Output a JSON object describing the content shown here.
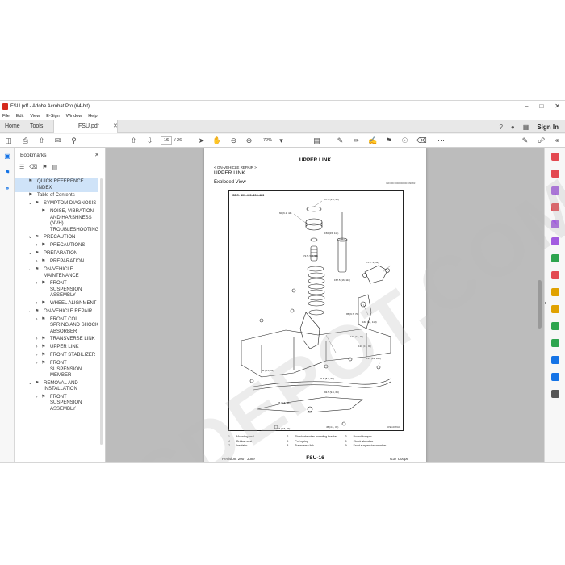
{
  "window": {
    "title": "FSU.pdf - Adobe Acrobat Pro (64-bit)"
  },
  "menu": [
    "File",
    "Edit",
    "View",
    "E-Sign",
    "Window",
    "Help"
  ],
  "tabs": {
    "home": "Home",
    "tools": "Tools",
    "document": "FSU.pdf",
    "sign_in": "Sign In"
  },
  "toolbar": {
    "current_page": "16",
    "page_total": "/ 26",
    "zoom": "72%"
  },
  "bookmarks": {
    "header": "Bookmarks",
    "items": [
      {
        "label": "QUICK REFERENCE INDEX",
        "level": 0,
        "expand": "",
        "selected": true
      },
      {
        "label": "Table of Contents",
        "level": 0,
        "expand": "",
        "selected": false
      },
      {
        "label": "SYMPTOM DIAGNOSIS",
        "level": 1,
        "expand": "v",
        "selected": false
      },
      {
        "label": "NOISE, VIBRATION AND HARSHNESS (NVH) TROUBLESHOOTING",
        "level": 2,
        "expand": "",
        "selected": false
      },
      {
        "label": "PRECAUTION",
        "level": 1,
        "expand": "v",
        "selected": false
      },
      {
        "label": "PRECAUTIONS",
        "level": 2,
        "expand": ">",
        "selected": false
      },
      {
        "label": "PREPARATION",
        "level": 1,
        "expand": "v",
        "selected": false
      },
      {
        "label": "PREPARATION",
        "level": 2,
        "expand": ">",
        "selected": false
      },
      {
        "label": "ON-VEHICLE MAINTENANCE",
        "level": 1,
        "expand": "v",
        "selected": false
      },
      {
        "label": "FRONT SUSPENSION ASSEMBLY",
        "level": 2,
        "expand": ">",
        "selected": false
      },
      {
        "label": "WHEEL ALIGNMENT",
        "level": 2,
        "expand": ">",
        "selected": false
      },
      {
        "label": "ON-VEHICLE REPAIR",
        "level": 1,
        "expand": "v",
        "selected": false
      },
      {
        "label": "FRONT COIL SPRING AND SHOCK ABSORBER",
        "level": 2,
        "expand": ">",
        "selected": false
      },
      {
        "label": "TRANSVERSE LINK",
        "level": 2,
        "expand": ">",
        "selected": false
      },
      {
        "label": "UPPER LINK",
        "level": 2,
        "expand": ">",
        "selected": false
      },
      {
        "label": "FRONT STABILIZER",
        "level": 2,
        "expand": ">",
        "selected": false
      },
      {
        "label": "FRONT SUSPENSION MEMBER",
        "level": 2,
        "expand": ">",
        "selected": false
      },
      {
        "label": "REMOVAL AND INSTALLATION",
        "level": 1,
        "expand": "v",
        "selected": false
      },
      {
        "label": "FRONT SUSPENSION ASSEMBLY",
        "level": 2,
        "expand": ">",
        "selected": false
      }
    ]
  },
  "page": {
    "title": "UPPER LINK",
    "breadcrumb": "< ON-VEHICLE REPAIR >",
    "subtitle": "UPPER LINK",
    "view_label": "Exploded View",
    "page_code": "INFOID:0000000001390817",
    "diagram_section": "SEC. 400•401•408•483",
    "diagram_code": "JPEIA0083GB",
    "legend": [
      [
        {
          "n": "1.",
          "t": "Mounting seal"
        },
        {
          "n": "2.",
          "t": "Shock absorber mounting bracket"
        },
        {
          "n": "3.",
          "t": "Bound bumper"
        }
      ],
      [
        {
          "n": "4.",
          "t": "Rubber seat"
        },
        {
          "n": "5.",
          "t": "Coil spring"
        },
        {
          "n": "6.",
          "t": "Shock absorber"
        }
      ],
      [
        {
          "n": "7.",
          "t": "Insulator"
        },
        {
          "n": "8.",
          "t": "Transverse link"
        },
        {
          "n": "9.",
          "t": "Front suspension member"
        }
      ]
    ],
    "callouts": [
      "37.3 (3.8, 28)",
      "60 (6.1, 44)",
      "70 (7.1, 52)",
      "150 (15, 111)",
      "72.5 (7.4, 53)",
      "157.5 (16, 116)",
      "95 (9.7, 70)",
      "160 (16, 118)",
      "130 (13, 96)",
      "130 (13, 96)",
      "135 (14, 100)",
      "81.5 (8.3, 60)",
      "93.5 (9.5, 69)",
      "44 (4.5, 32)",
      "65 (6.6, 48)",
      "44 (4.5, 33)",
      "45 (4.6, 33)"
    ],
    "footer_left": "Revision: 2007 June",
    "footer_center": "FSU-16",
    "footer_right": "G37 Coupe"
  },
  "watermark": "PCDEPOT.COM",
  "colors": {
    "accent": "#1473e6",
    "pdf_red": "#d52b1e",
    "selected_bg": "#cfe3f8",
    "doc_bg": "#bcbcbc"
  }
}
